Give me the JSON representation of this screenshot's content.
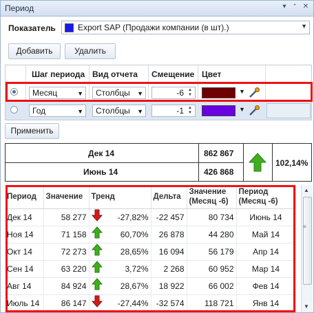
{
  "window": {
    "title": "Период",
    "pin_glyph": "▾",
    "pin2_glyph": "ᐩ",
    "close_glyph": "✕"
  },
  "indicator": {
    "label": "Показатель",
    "value": "Export SAP (Продажи компании (в шт).)",
    "color": "#1a1aee"
  },
  "toolbar": {
    "add_label": "Добавить",
    "delete_label": "Удалить",
    "apply_label": "Применить"
  },
  "periods_grid": {
    "headers": {
      "step": "Шаг периода",
      "report": "Вид отчета",
      "offset": "Смещение",
      "color": "Цвет"
    },
    "rows": [
      {
        "step": "Месяц",
        "report": "Столбцы",
        "offset": "-6",
        "color": "#6e0000",
        "selected": true
      },
      {
        "step": "Год",
        "report": "Столбцы",
        "offset": "-1",
        "color": "#6a00e0",
        "selected": false
      }
    ]
  },
  "summary": {
    "row1_period": "Дек 14",
    "row1_value": "862 867",
    "row2_period": "Июнь 14",
    "row2_value": "426 868",
    "percent": "102,14%",
    "trend": "up"
  },
  "table": {
    "headers": {
      "period": "Период",
      "value": "Значение",
      "trend": "Тренд",
      "delta": "Дельта",
      "value_offset": "Значение (Месяц -6)",
      "period_offset": "Период (Месяц -6)"
    },
    "rows": [
      {
        "period": "Дек 14",
        "value": "58 277",
        "trend": "down",
        "pct": "-27,82%",
        "delta": "-22 457",
        "value_offset": "80 734",
        "period_offset": "Июнь 14"
      },
      {
        "period": "Ноя 14",
        "value": "71 158",
        "trend": "up",
        "pct": "60,70%",
        "delta": "26 878",
        "value_offset": "44 280",
        "period_offset": "Май 14"
      },
      {
        "period": "Окт 14",
        "value": "72 273",
        "trend": "up",
        "pct": "28,65%",
        "delta": "16 094",
        "value_offset": "56 179",
        "period_offset": "Апр 14"
      },
      {
        "period": "Сен 14",
        "value": "63 220",
        "trend": "up",
        "pct": "3,72%",
        "delta": "2 268",
        "value_offset": "60 952",
        "period_offset": "Мар 14"
      },
      {
        "period": "Авг 14",
        "value": "84 924",
        "trend": "up",
        "pct": "28,67%",
        "delta": "18 922",
        "value_offset": "66 002",
        "period_offset": "Фев 14"
      },
      {
        "period": "Июль 14",
        "value": "86 147",
        "trend": "down",
        "pct": "-27,44%",
        "delta": "-32 574",
        "value_offset": "118 721",
        "period_offset": "Янв 14"
      }
    ]
  },
  "colors": {
    "highlight": "#e11111",
    "up_arrow": "#3fae1f",
    "down_arrow": "#d21c1c"
  }
}
